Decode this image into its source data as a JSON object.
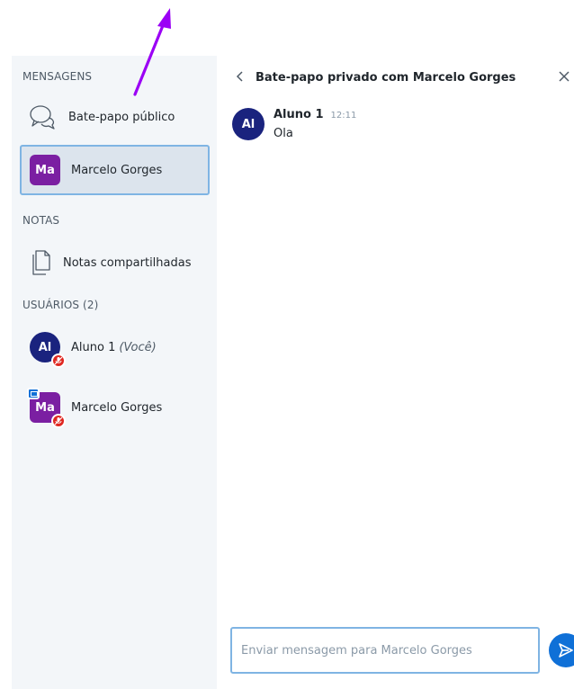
{
  "sidebar": {
    "messages_title": "MENSAGENS",
    "public_chat_label": "Bate-papo público",
    "private_chat": {
      "initials": "Ma",
      "label": "Marcelo Gorges"
    },
    "notes_title": "NOTAS",
    "shared_notes_label": "Notas compartilhadas",
    "users_title": "USUÁRIOS (2)",
    "users": [
      {
        "initials": "Al",
        "name": "Aluno 1",
        "suffix": "(Você)"
      },
      {
        "initials": "Ma",
        "name": "Marcelo Gorges"
      }
    ]
  },
  "chat": {
    "title": "Bate-papo privado com Marcelo Gorges",
    "messages": [
      {
        "initials": "Al",
        "author": "Aluno 1",
        "time": "12:11",
        "text": "Ola"
      }
    ],
    "input_placeholder": "Enviar mensagem para Marcelo Gorges"
  },
  "icons": {
    "chat": "chat-bubbles-icon",
    "notes": "document-icon",
    "back": "chevron-left-icon",
    "close": "close-icon",
    "send": "send-icon",
    "muted_mic": "muted-microphone-icon",
    "presenter": "presenter-icon"
  },
  "colors": {
    "sidebar_bg": "#f3f6f9",
    "active_bg": "#dce4ed",
    "active_border": "#7fb4e3",
    "purple_avatar": "#7b1fa2",
    "navy_avatar": "#1a237e",
    "primary": "#0f70d7",
    "danger": "#df2721",
    "annotation_arrow": "#9b00f5"
  }
}
